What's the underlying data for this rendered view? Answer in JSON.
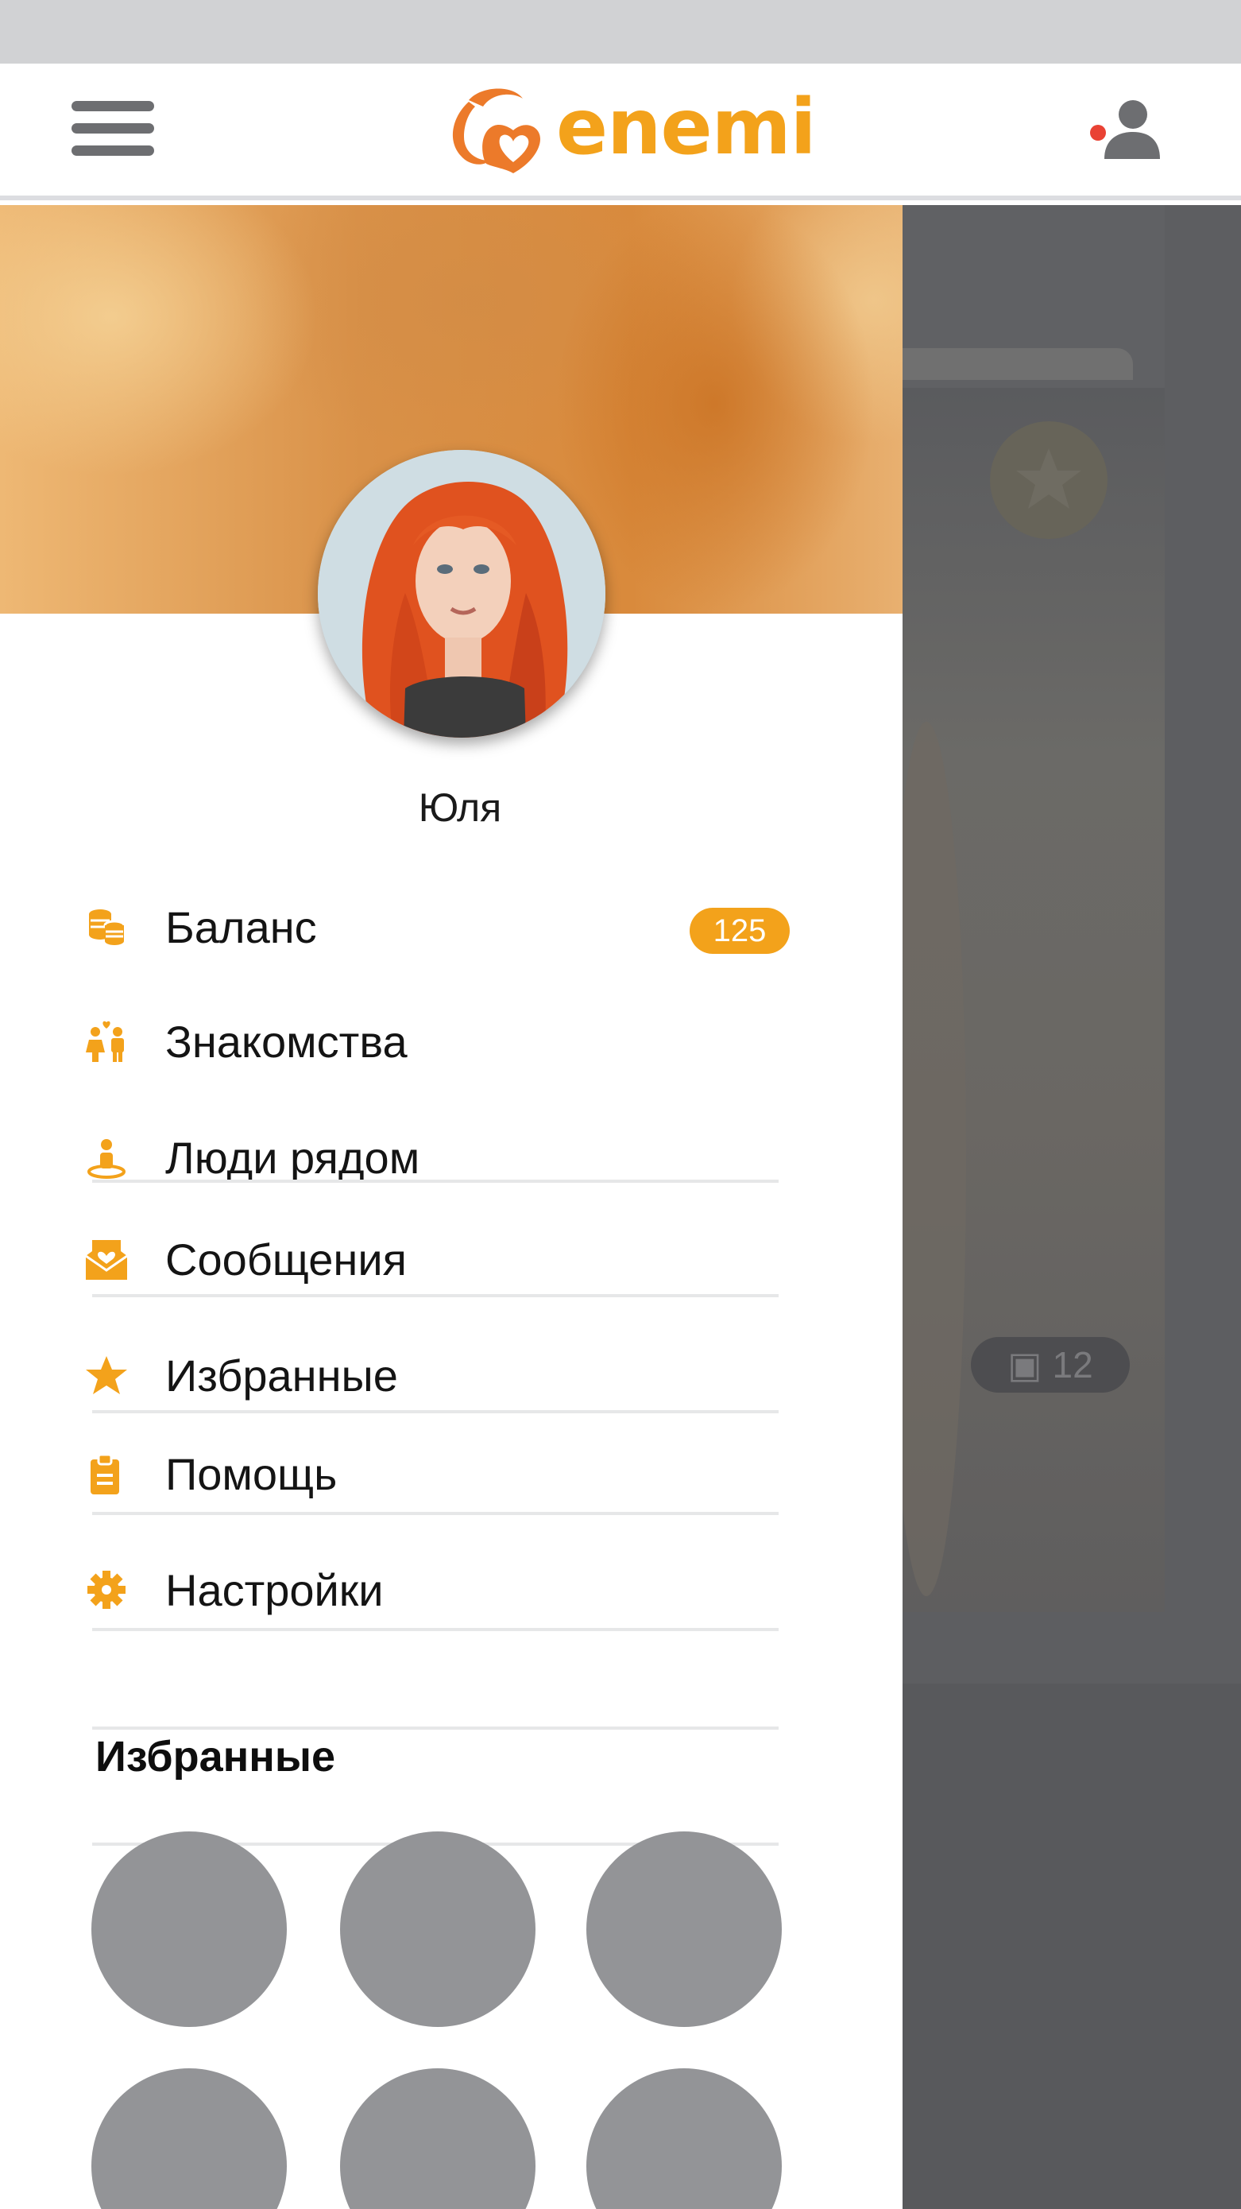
{
  "header": {
    "logo_text": "enemi",
    "menu_icon": "hamburger-menu-icon",
    "profile_icon": "user-icon",
    "notification_color": "#e94234"
  },
  "colors": {
    "accent": "#f3a21b",
    "logo_orange": "#ec7a2a",
    "overlay": "#5d5e61",
    "placeholder": "#939497"
  },
  "drawer": {
    "user": {
      "name": "Юля"
    },
    "menu": [
      {
        "label": "Баланс",
        "icon": "coins-icon",
        "badge": "125"
      },
      {
        "label": "Знакомства",
        "icon": "couple-icon"
      },
      {
        "label": "Люди рядом",
        "icon": "location-person-icon"
      },
      {
        "label": "Сообщения",
        "icon": "heart-envelope-icon"
      },
      {
        "label": "Избранные",
        "icon": "star-icon"
      },
      {
        "label": "Помощь",
        "icon": "help-clipboard-icon"
      },
      {
        "label": "Настройки",
        "icon": "gear-icon"
      }
    ],
    "favorites": {
      "title": "Избранные",
      "items": [
        "",
        "",
        "",
        "",
        "",
        ""
      ]
    }
  },
  "background": {
    "photo_count": "12",
    "photo_count_icon": "camera-icon",
    "favorite_icon": "star-icon"
  }
}
